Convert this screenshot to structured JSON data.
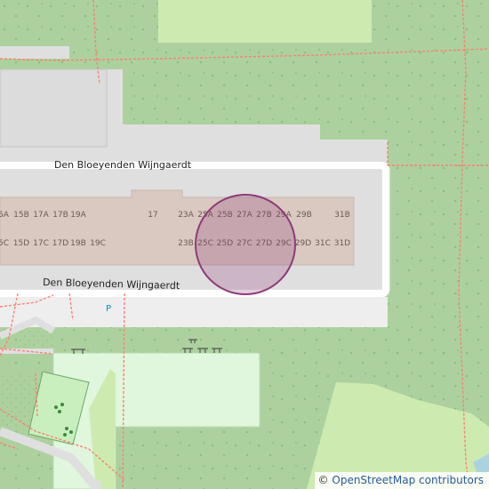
{
  "map": {
    "streets": [
      "Den Bloeyenden Wijngaerdt",
      "Den Bloeyenden Wijngaerdt"
    ],
    "parking_label": "P",
    "house_numbers_row1": [
      "5A",
      "15B",
      "17A",
      "17B",
      "19A",
      "17",
      "23A",
      "25A",
      "25B",
      "27A",
      "27B",
      "29A",
      "29B",
      "31B"
    ],
    "house_numbers_row2": [
      "5C",
      "15D",
      "17C",
      "17D",
      "19B",
      "19C",
      "23B",
      "25C",
      "25D",
      "27C",
      "27D",
      "29C",
      "29D",
      "31C",
      "31D"
    ],
    "marker": {
      "type": "circle",
      "color": "#8e3a78"
    },
    "attribution": {
      "symbol": "©",
      "text": "OpenStreetMap contributors"
    }
  },
  "colors": {
    "wood": "#add19e",
    "meadow": "#cdebb0",
    "park": "#e0f7dd",
    "residential": "#e0dfdf",
    "building": "#d9c9c0",
    "road": "#ffffff",
    "path": "#fa8072"
  }
}
